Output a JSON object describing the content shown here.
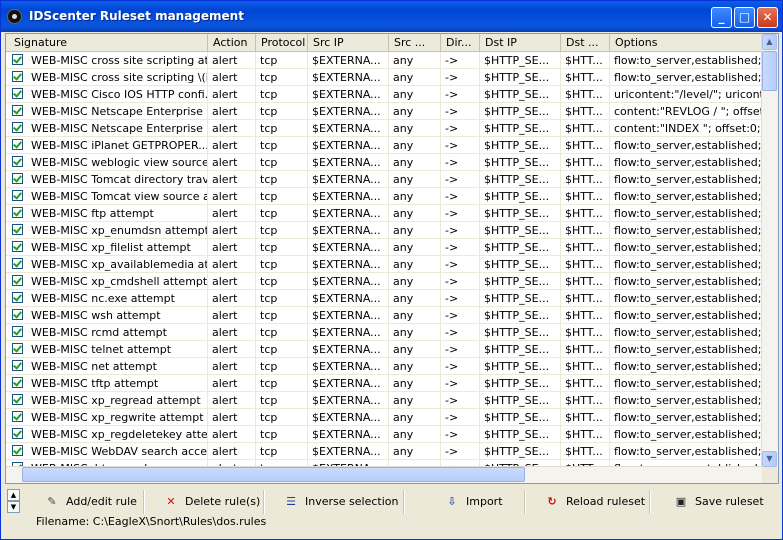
{
  "window": {
    "title": "IDScenter Ruleset management",
    "min": "_",
    "max": "□",
    "close": "✕"
  },
  "columns": [
    "Signature",
    "Action",
    "Protocol",
    "Src IP",
    "Src ...",
    "Dir...",
    "Dst IP",
    "Dst ...",
    "Options"
  ],
  "rows": [
    [
      "WEB-MISC cross site scripting atte...",
      "alert",
      "tcp",
      "$EXTERNA...",
      "any",
      "->",
      "$HTTP_SE...",
      "$HTT...",
      "flow:to_server,established; cont"
    ],
    [
      "WEB-MISC cross site scripting \\(im...",
      "alert",
      "tcp",
      "$EXTERNA...",
      "any",
      "->",
      "$HTTP_SE...",
      "$HTT...",
      "flow:to_server,established; cont"
    ],
    [
      "WEB-MISC Cisco IOS HTTP confi...",
      "alert",
      "tcp",
      "$EXTERNA...",
      "any",
      "->",
      "$HTTP_SE...",
      "$HTT...",
      "uricontent:\"/level/\"; uricontent:\""
    ],
    [
      "WEB-MISC Netscape Enterprise D...",
      "alert",
      "tcp",
      "$EXTERNA...",
      "any",
      "->",
      "$HTTP_SE...",
      "$HTT...",
      "content:\"REVLOG / \"; offset:0;"
    ],
    [
      "WEB-MISC Netscape Enterprise di...",
      "alert",
      "tcp",
      "$EXTERNA...",
      "any",
      "->",
      "$HTTP_SE...",
      "$HTT...",
      "content:\"INDEX \"; offset:0; dep"
    ],
    [
      "WEB-MISC iPlanet GETPROPER...",
      "alert",
      "tcp",
      "$EXTERNA...",
      "any",
      "->",
      "$HTTP_SE...",
      "$HTT...",
      "flow:to_server,established; cont"
    ],
    [
      "WEB-MISC weblogic view source ...",
      "alert",
      "tcp",
      "$EXTERNA...",
      "any",
      "->",
      "$HTTP_SE...",
      "$HTT...",
      "flow:to_server,established; uric"
    ],
    [
      "WEB-MISC Tomcat directory trave...",
      "alert",
      "tcp",
      "$EXTERNA...",
      "any",
      "->",
      "$HTTP_SE...",
      "$HTT...",
      "flow:to_server,established; uric"
    ],
    [
      "WEB-MISC Tomcat view source a...",
      "alert",
      "tcp",
      "$EXTERNA...",
      "any",
      "->",
      "$HTTP_SE...",
      "$HTT...",
      "flow:to_server,established; uric"
    ],
    [
      "WEB-MISC ftp attempt",
      "alert",
      "tcp",
      "$EXTERNA...",
      "any",
      "->",
      "$HTTP_SE...",
      "$HTT...",
      "flow:to_server,established; cont"
    ],
    [
      "WEB-MISC xp_enumdsn attempt",
      "alert",
      "tcp",
      "$EXTERNA...",
      "any",
      "->",
      "$HTTP_SE...",
      "$HTT...",
      "flow:to_server,established; cont"
    ],
    [
      "WEB-MISC xp_filelist attempt",
      "alert",
      "tcp",
      "$EXTERNA...",
      "any",
      "->",
      "$HTTP_SE...",
      "$HTT...",
      "flow:to_server,established; cont"
    ],
    [
      "WEB-MISC xp_availablemedia att...",
      "alert",
      "tcp",
      "$EXTERNA...",
      "any",
      "->",
      "$HTTP_SE...",
      "$HTT...",
      "flow:to_server,established; cont"
    ],
    [
      "WEB-MISC xp_cmdshell attempt",
      "alert",
      "tcp",
      "$EXTERNA...",
      "any",
      "->",
      "$HTTP_SE...",
      "$HTT...",
      "flow:to_server,established; cont"
    ],
    [
      "WEB-MISC nc.exe attempt",
      "alert",
      "tcp",
      "$EXTERNA...",
      "any",
      "->",
      "$HTTP_SE...",
      "$HTT...",
      "flow:to_server,established; cont"
    ],
    [
      "WEB-MISC wsh attempt",
      "alert",
      "tcp",
      "$EXTERNA...",
      "any",
      "->",
      "$HTTP_SE...",
      "$HTT...",
      "flow:to_server,established; cont"
    ],
    [
      "WEB-MISC rcmd attempt",
      "alert",
      "tcp",
      "$EXTERNA...",
      "any",
      "->",
      "$HTTP_SE...",
      "$HTT...",
      "flow:to_server,established; cont"
    ],
    [
      "WEB-MISC telnet attempt",
      "alert",
      "tcp",
      "$EXTERNA...",
      "any",
      "->",
      "$HTTP_SE...",
      "$HTT...",
      "flow:to_server,established; cont"
    ],
    [
      "WEB-MISC net attempt",
      "alert",
      "tcp",
      "$EXTERNA...",
      "any",
      "->",
      "$HTTP_SE...",
      "$HTT...",
      "flow:to_server,established; cont"
    ],
    [
      "WEB-MISC tftp attempt",
      "alert",
      "tcp",
      "$EXTERNA...",
      "any",
      "->",
      "$HTTP_SE...",
      "$HTT...",
      "flow:to_server,established; cont"
    ],
    [
      "WEB-MISC xp_regread attempt",
      "alert",
      "tcp",
      "$EXTERNA...",
      "any",
      "->",
      "$HTTP_SE...",
      "$HTT...",
      "flow:to_server,established; cont"
    ],
    [
      "WEB-MISC xp_regwrite attempt",
      "alert",
      "tcp",
      "$EXTERNA...",
      "any",
      "->",
      "$HTTP_SE...",
      "$HTT...",
      "flow:to_server,established; cont"
    ],
    [
      "WEB-MISC xp_regdeletekey attempt",
      "alert",
      "tcp",
      "$EXTERNA...",
      "any",
      "->",
      "$HTTP_SE...",
      "$HTT...",
      "flow:to_server,established; cont"
    ],
    [
      "WEB-MISC WebDAV search acce...",
      "alert",
      "tcp",
      "$EXTERNA...",
      "any",
      "->",
      "$HTTP_SE...",
      "$HTT...",
      "flow:to_server,established; cont"
    ],
    [
      "WEB-MISC .htpasswd access",
      "alert",
      "tcp",
      "$EXTERNA...",
      "any",
      "->",
      "$HTTP_SE...",
      "$HTT...",
      "flow:to_server,established; cont"
    ]
  ],
  "toolbar": {
    "add": "Add/edit rule",
    "delete": "Delete rule(s)",
    "inverse": "Inverse selection",
    "import": "Import",
    "reload": "Reload ruleset",
    "save": "Save ruleset"
  },
  "status": "Filename: C:\\EagleX\\Snort\\Rules\\dos.rules"
}
